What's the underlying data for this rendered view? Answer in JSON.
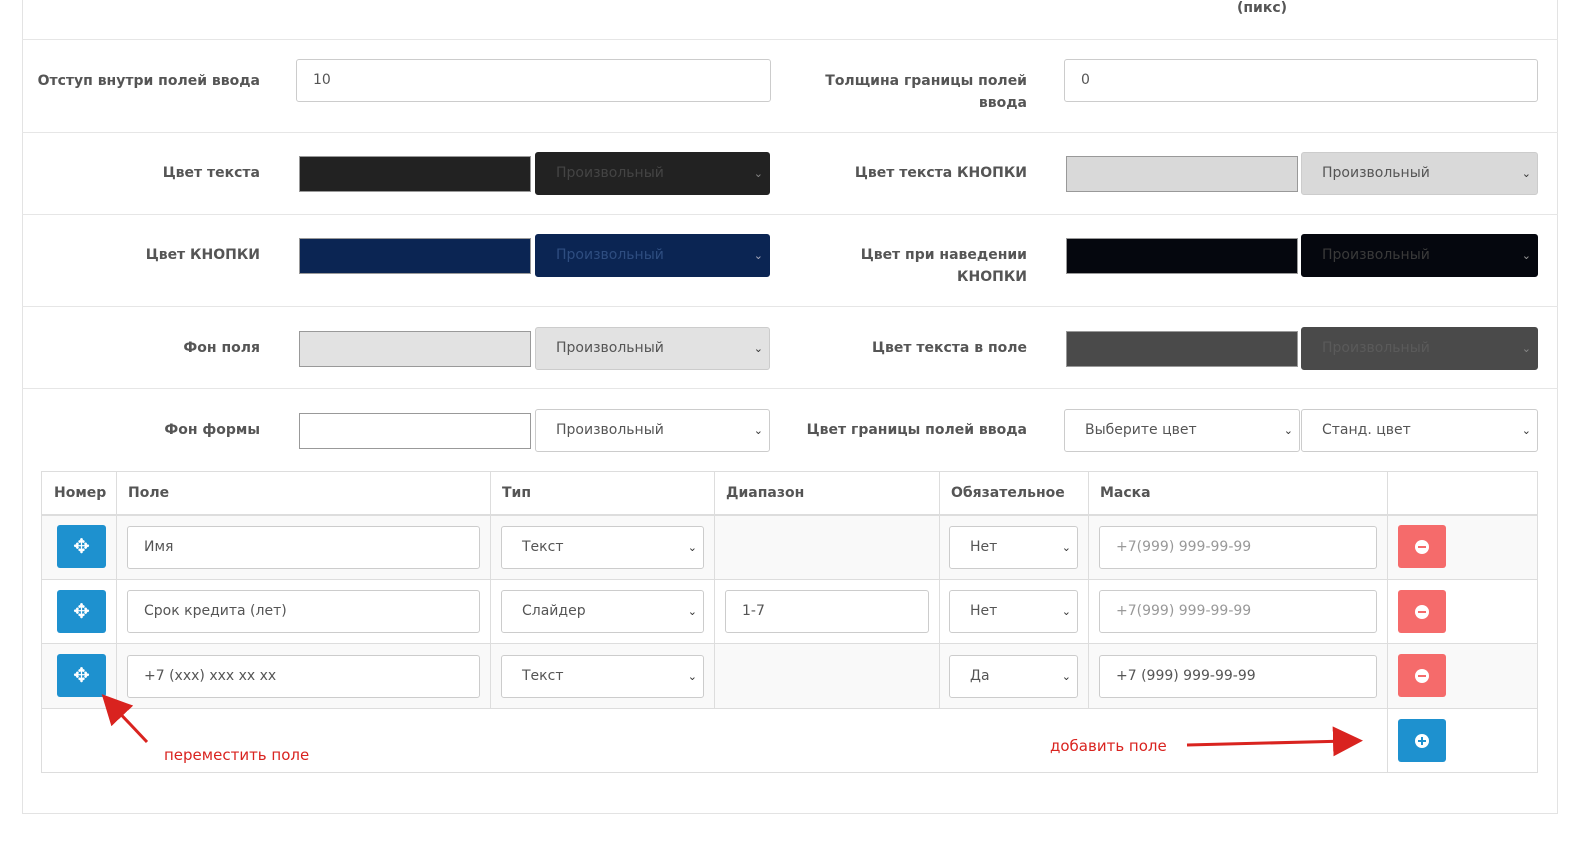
{
  "top_unit": "(пикс)",
  "settings": {
    "padding_label": "Отступ внутри полей ввода",
    "padding_value": "10",
    "border_width_label": "Толщина границы полей ввода",
    "border_width_value": "0",
    "text_color_label": "Цвет текста",
    "text_color_swatch": "#222222",
    "text_color_select": "Произвольный",
    "button_text_color_label": "Цвет текста КНОПКИ",
    "button_text_color_swatch": "#d9d9d9",
    "button_text_color_select": "Произвольный",
    "button_color_label": "Цвет КНОПКИ",
    "button_color_swatch": "#0b2553",
    "button_color_select": "Произвольный",
    "button_hover_label": "Цвет при наведении КНОПКИ",
    "button_hover_swatch": "#05070e",
    "button_hover_select": "Произвольный",
    "field_bg_label": "Фон поля",
    "field_bg_swatch": "#e2e2e2",
    "field_bg_select": "Произвольный",
    "field_text_color_label": "Цвет текста в поле",
    "field_text_color_swatch": "#4a4a4a",
    "field_text_color_select": "Произвольный",
    "form_bg_label": "Фон формы",
    "form_bg_swatch": "#ffffff",
    "form_bg_select": "Произвольный",
    "input_border_color_label": "Цвет границы полей ввода",
    "input_border_color_select1": "Выберите цвет",
    "input_border_color_select2": "Станд. цвет"
  },
  "table": {
    "headers": [
      "Номер",
      "Поле",
      "Тип",
      "Диапазон",
      "Обязательное",
      "Маска"
    ],
    "rows": [
      {
        "field": "Имя",
        "type": "Текст",
        "range": "",
        "required": "Нет",
        "mask": "+7(999) 999-99-99",
        "mask_is_placeholder": true
      },
      {
        "field": "Срок кредита (лет)",
        "type": "Слайдер",
        "range": "1-7",
        "required": "Нет",
        "mask": "+7(999) 999-99-99",
        "mask_is_placeholder": true
      },
      {
        "field": "+7 (xxx) xxx xx xx",
        "type": "Текст",
        "range": "",
        "required": "Да",
        "mask": "+7 (999) 999-99-99",
        "mask_is_placeholder": false
      }
    ]
  },
  "annotations": {
    "move": "переместить поле",
    "add": "добавить поле"
  },
  "colors": {
    "accent_blue": "#1e91cf",
    "delete_red": "#f56b6b",
    "annotation_red": "#d9231f"
  },
  "icons": {
    "move": "arrows-move-icon",
    "delete": "minus-circle-icon",
    "add": "plus-circle-icon",
    "dropdown": "chevron-down-icon"
  }
}
